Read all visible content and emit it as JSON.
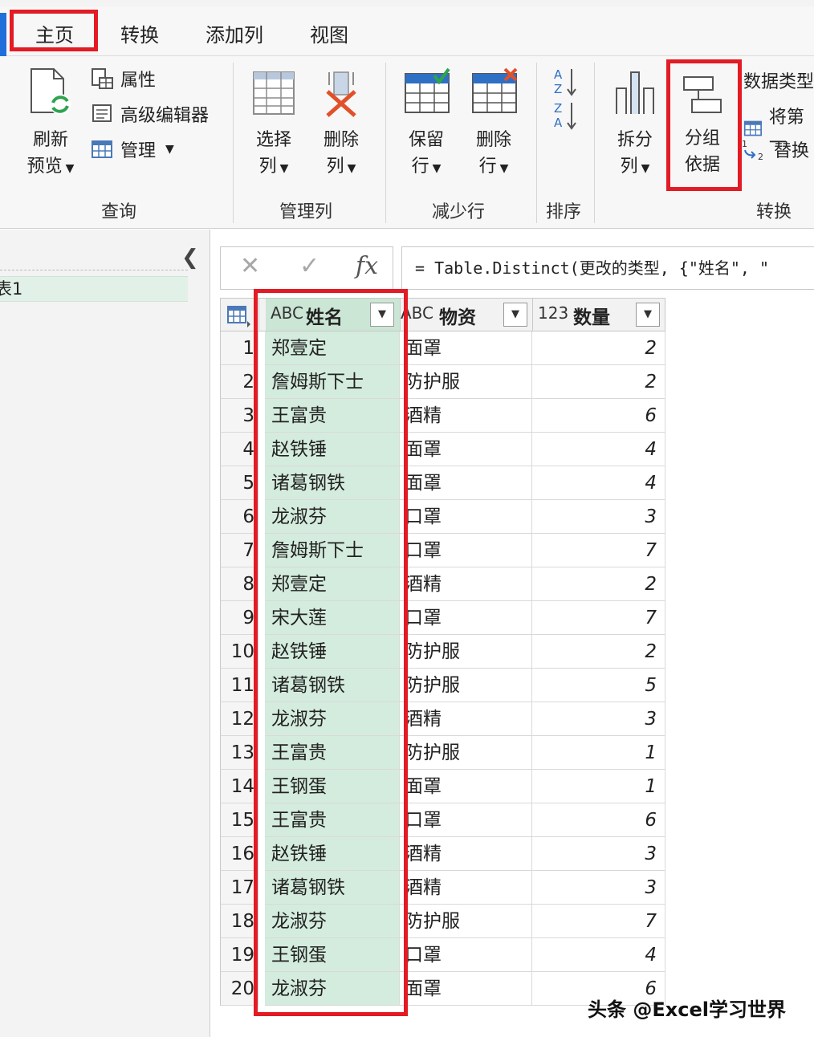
{
  "tabs": {
    "home": "主页",
    "transform": "转换",
    "add_column": "添加列",
    "view": "视图"
  },
  "ribbon": {
    "refresh_preview": [
      "刷新",
      "预览"
    ],
    "properties": "属性",
    "advanced_editor": "高级编辑器",
    "manage": "管理",
    "choose_columns": [
      "选择",
      "列"
    ],
    "remove_columns": [
      "删除",
      "列"
    ],
    "keep_rows": [
      "保留",
      "行"
    ],
    "remove_rows": [
      "删除",
      "行"
    ],
    "split_column": [
      "拆分",
      "列"
    ],
    "group_by": [
      "分组",
      "依据"
    ],
    "data_type": "数据类型",
    "use_first_row": "将第一",
    "replace_values": "替换",
    "groups": {
      "query": "查询",
      "manage_columns": "管理列",
      "reduce_rows": "减少行",
      "sort": "排序",
      "transform": "转换"
    }
  },
  "left_pane": {
    "query_name": "表1"
  },
  "formula_bar": {
    "formula": "= Table.Distinct(更改的类型, {\"姓名\", \""
  },
  "grid": {
    "columns": [
      {
        "type": "ABC",
        "name": "姓名"
      },
      {
        "type": "ABC",
        "name": "物资"
      },
      {
        "type": "123",
        "name": "数量"
      }
    ],
    "rows": [
      {
        "n": "1",
        "name": "郑壹定",
        "mat": "面罩",
        "qty": "2"
      },
      {
        "n": "2",
        "name": "詹姆斯下士",
        "mat": "防护服",
        "qty": "2"
      },
      {
        "n": "3",
        "name": "王富贵",
        "mat": "酒精",
        "qty": "6"
      },
      {
        "n": "4",
        "name": "赵铁锤",
        "mat": "面罩",
        "qty": "4"
      },
      {
        "n": "5",
        "name": "诸葛钢铁",
        "mat": "面罩",
        "qty": "4"
      },
      {
        "n": "6",
        "name": "龙淑芬",
        "mat": "口罩",
        "qty": "3"
      },
      {
        "n": "7",
        "name": "詹姆斯下士",
        "mat": "口罩",
        "qty": "7"
      },
      {
        "n": "8",
        "name": "郑壹定",
        "mat": "酒精",
        "qty": "2"
      },
      {
        "n": "9",
        "name": "宋大莲",
        "mat": "口罩",
        "qty": "7"
      },
      {
        "n": "10",
        "name": "赵铁锤",
        "mat": "防护服",
        "qty": "2"
      },
      {
        "n": "11",
        "name": "诸葛钢铁",
        "mat": "防护服",
        "qty": "5"
      },
      {
        "n": "12",
        "name": "龙淑芬",
        "mat": "酒精",
        "qty": "3"
      },
      {
        "n": "13",
        "name": "王富贵",
        "mat": "防护服",
        "qty": "1"
      },
      {
        "n": "14",
        "name": "王钢蛋",
        "mat": "面罩",
        "qty": "1"
      },
      {
        "n": "15",
        "name": "王富贵",
        "mat": "口罩",
        "qty": "6"
      },
      {
        "n": "16",
        "name": "赵铁锤",
        "mat": "酒精",
        "qty": "3"
      },
      {
        "n": "17",
        "name": "诸葛钢铁",
        "mat": "酒精",
        "qty": "3"
      },
      {
        "n": "18",
        "name": "龙淑芬",
        "mat": "防护服",
        "qty": "7"
      },
      {
        "n": "19",
        "name": "王钢蛋",
        "mat": "口罩",
        "qty": "4"
      },
      {
        "n": "20",
        "name": "龙淑芬",
        "mat": "面罩",
        "qty": "6"
      }
    ]
  },
  "watermark": "头条 @Excel学习世界",
  "colors": {
    "highlight_red": "#e21b24",
    "selected_column": "#d4ecdd",
    "accent_blue": "#1e6fd9"
  },
  "icons": [
    "refresh-icon",
    "properties-icon",
    "advanced-editor-icon",
    "manage-table-icon",
    "choose-columns-icon",
    "remove-columns-icon",
    "keep-rows-icon",
    "remove-rows-icon",
    "sort-ascending-icon",
    "sort-descending-icon",
    "split-column-icon",
    "group-by-icon",
    "cancel-icon",
    "confirm-icon",
    "fx-icon",
    "table-corner-icon",
    "filter-dropdown-icon"
  ]
}
